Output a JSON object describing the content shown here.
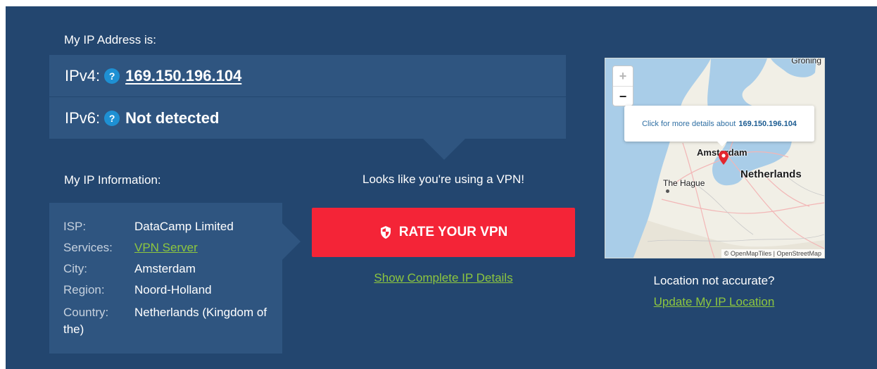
{
  "header": {
    "my_ip_label": "My IP Address is:"
  },
  "ipv4": {
    "label": "IPv4:",
    "help": "?",
    "value": "169.150.196.104"
  },
  "ipv6": {
    "label": "IPv6:",
    "help": "?",
    "value": "Not detected"
  },
  "info": {
    "title": "My IP Information:",
    "rows": [
      {
        "key": "ISP:",
        "value": "DataCamp Limited"
      },
      {
        "key": "Services:",
        "value": "VPN Server"
      },
      {
        "key": "City:",
        "value": "Amsterdam"
      },
      {
        "key": "Region:",
        "value": "Noord-Holland"
      },
      {
        "key": "Country:",
        "value": "Netherlands (Kingdom of the)"
      }
    ]
  },
  "vpn": {
    "message": "Looks like you're using a VPN!",
    "rate_button": "RATE YOUR VPN",
    "details_link": "Show Complete IP Details",
    "icon": "shield-icon"
  },
  "map": {
    "zoom_in": "+",
    "zoom_out": "−",
    "popup_text": "Click for more details about",
    "popup_ip": "169.150.196.104",
    "labels": {
      "amsterdam": "Amsterdam",
      "the_hague": "The Hague",
      "netherlands": "Netherlands",
      "groningen": "Groning"
    },
    "attribution": "© OpenMapTiles | OpenStreetMap"
  },
  "location": {
    "question": "Location not accurate?",
    "update_link": "Update My IP Location"
  },
  "colors": {
    "panel": "#23466f",
    "box": "#2f5580",
    "accent_red": "#f42437",
    "link_green": "#8dc63f",
    "help_blue": "#1e90d3"
  }
}
